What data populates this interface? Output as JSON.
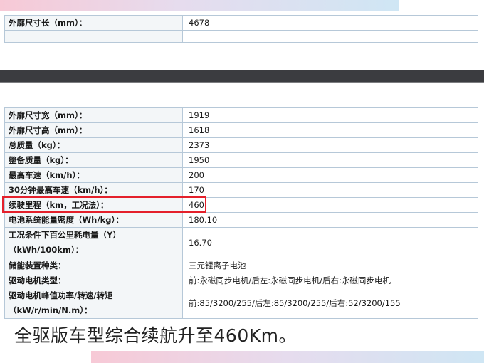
{
  "top_table": {
    "rows": [
      {
        "label": "外廓尺寸长（mm）：",
        "value": "4678"
      }
    ]
  },
  "main_table": {
    "rows": [
      {
        "label": "外廓尺寸宽（mm）：",
        "value": "1919"
      },
      {
        "label": "外廓尺寸高（mm）：",
        "value": "1618"
      },
      {
        "label": "总质量（kg）：",
        "value": "2373"
      },
      {
        "label": "整备质量（kg）：",
        "value": "1950"
      },
      {
        "label": "最高车速（km/h）：",
        "value": "200"
      },
      {
        "label": "30分钟最高车速（km/h）：",
        "value": "170"
      },
      {
        "label": "续驶里程（km，工况法）：",
        "value": "460"
      },
      {
        "label": "电池系统能量密度（Wh/kg）：",
        "value": "180.10"
      },
      {
        "label": "工况条件下百公里耗电量（Y）（kWh/100km）：",
        "value": "16.70"
      },
      {
        "label": "储能装置种类：",
        "value": "三元锂离子电池"
      },
      {
        "label": "驱动电机类型：",
        "value": "前:永磁同步电机/后左:永磁同步电机/后右:永磁同步电机"
      },
      {
        "label": "驱动电机峰值功率/转速/转矩（kW/r/min/N.m）：",
        "value": "前:85/3200/255/后左:85/3200/255/后右:52/3200/155"
      }
    ]
  },
  "caption": "全驱版车型综合续航升至460Km。",
  "colors": {
    "highlight": "#e4202b",
    "table_border": "#b6c8d8",
    "band": "#3b3c40"
  }
}
